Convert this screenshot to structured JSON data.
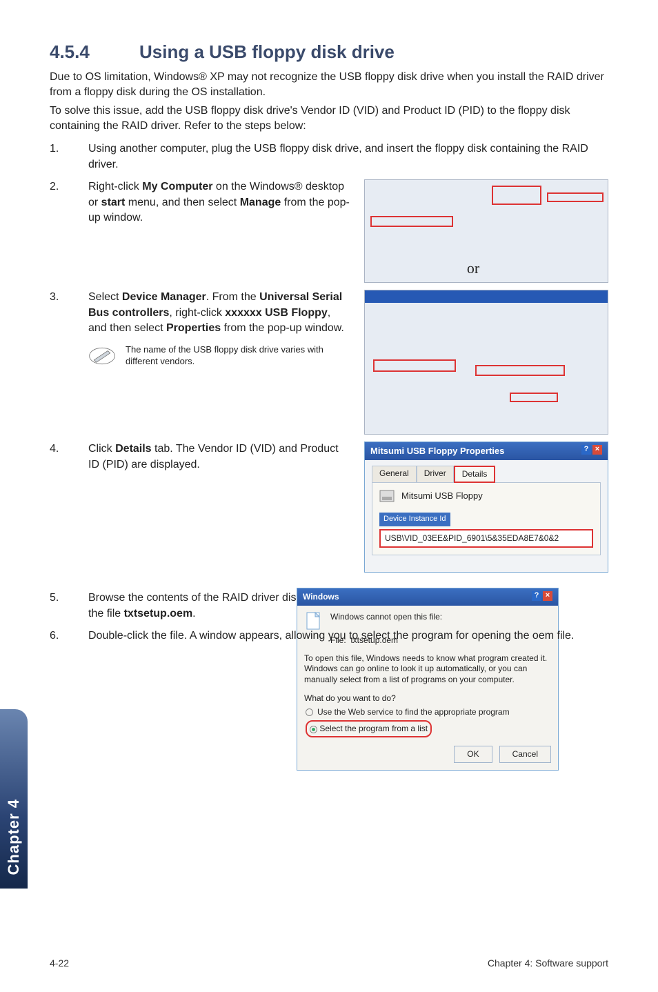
{
  "heading": {
    "number": "4.5.4",
    "title": "Using a USB floppy disk drive"
  },
  "intro1": "Due to OS limitation, Windows® XP may not recognize the USB floppy disk drive when you install the RAID driver from a floppy disk during the OS installation.",
  "intro2": "To solve this issue, add the USB floppy disk drive's Vendor ID (VID) and Product ID (PID) to the floppy disk containing the RAID driver. Refer to the steps below:",
  "steps": {
    "s1": "Using another computer, plug the USB floppy disk drive, and insert the floppy disk containing the RAID driver.",
    "s2a": "Right-click ",
    "s2b": "My Computer",
    "s2c": " on the Windows® desktop or ",
    "s2d": "start",
    "s2e": " menu, and then select ",
    "s2f": "Manage",
    "s2g": " from the pop-up window.",
    "s3a": "Select ",
    "s3b": "Device Manager",
    "s3c": ". From the ",
    "s3d": "Universal Serial Bus controllers",
    "s3e": ", right-click ",
    "s3f": "xxxxxx USB Floppy",
    "s3g": ", and then select ",
    "s3h": "Properties",
    "s3i": " from the pop-up window.",
    "s4a": "Click ",
    "s4b": "Details",
    "s4c": " tab. The Vendor ID (VID) and Product ID (PID) are displayed.",
    "s5a": "Browse the contents of the RAID driver disk to locate the file ",
    "s5b": "txtsetup.oem",
    "s5c": ".",
    "s6": "Double-click the file. A window appears, allowing you to select the program for opening the oem file."
  },
  "note": "The name of the USB floppy disk drive varies with different vendors.",
  "or": "or",
  "properties_dialog": {
    "title": "Mitsumi USB Floppy Properties",
    "tab_general": "General",
    "tab_driver": "Driver",
    "tab_details": "Details",
    "device_name": "Mitsumi USB Floppy",
    "combo_label": "Device Instance Id",
    "combo_value": "USB\\VID_03EE&PID_6901\\5&35EDA8E7&0&2"
  },
  "windows_dialog": {
    "title": "Windows",
    "msg": "Windows cannot open this file:",
    "file_label": "File:",
    "file_name": "txtsetup.oem",
    "para": "To open this file, Windows needs to know what program created it. Windows can go online to look it up automatically, or you can manually select from a list of programs on your computer.",
    "what": "What do you want to do?",
    "opt1": "Use the Web service to find the appropriate program",
    "opt2": "Select the program from a list",
    "ok": "OK",
    "cancel": "Cancel"
  },
  "sidestrip": "Chapter 4",
  "footer_left": "4-22",
  "footer_right": "Chapter 4: Software support"
}
